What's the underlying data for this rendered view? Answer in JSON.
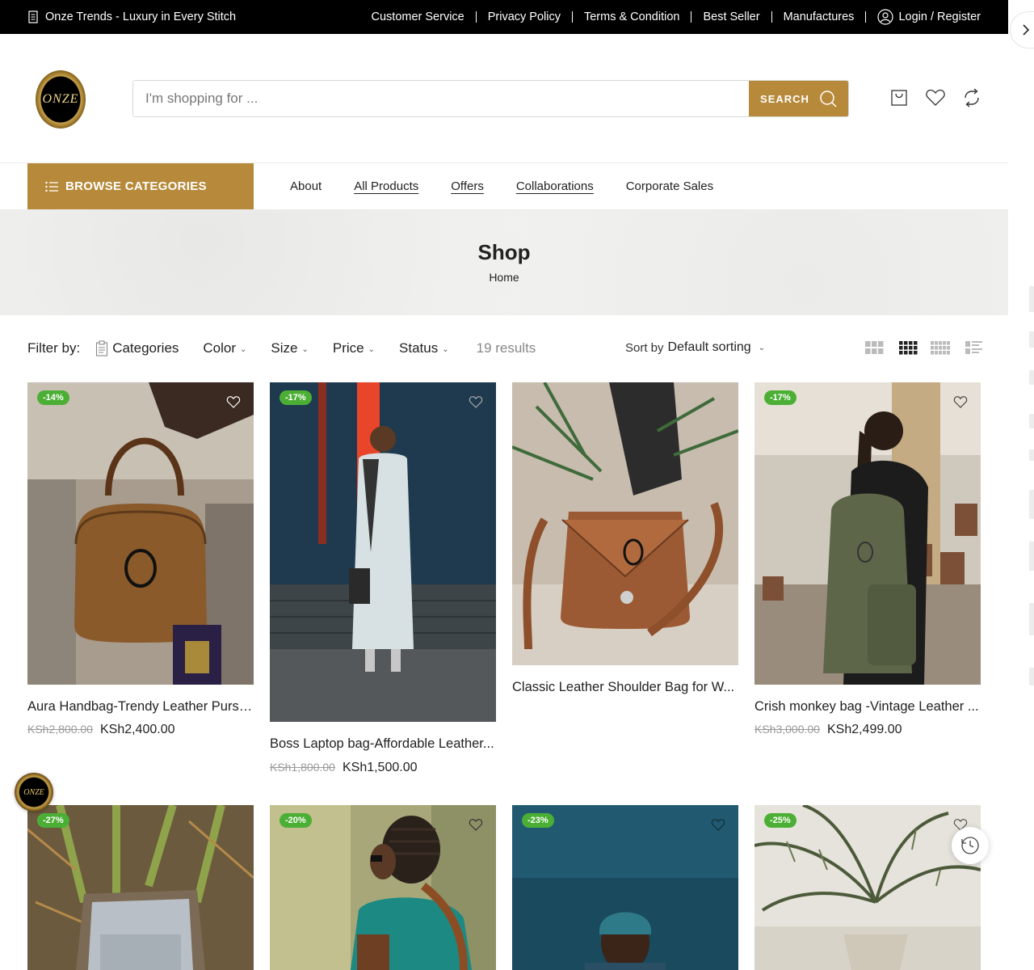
{
  "topbar": {
    "tagline": "Onze Trends - Luxury in Every Stitch",
    "links": [
      "Customer Service",
      "Privacy Policy",
      "Terms & Condition",
      "Best Seller",
      "Manufactures"
    ],
    "login": "Login / Register"
  },
  "header": {
    "logo_text": "ONZE",
    "search": {
      "placeholder": "I'm shopping for ...",
      "value": "",
      "button": "SEARCH"
    }
  },
  "nav": {
    "browse": "BROWSE CATEGORIES",
    "links": [
      "About",
      "All Products",
      "Offers",
      "Collaborations",
      "Corporate Sales"
    ]
  },
  "banner": {
    "title": "Shop",
    "breadcrumb": "Home"
  },
  "filters": {
    "label": "Filter by:",
    "items": [
      "Categories",
      "Color",
      "Size",
      "Price",
      "Status"
    ],
    "results": "19 results",
    "sort_prefix": "Sort by",
    "sort_value": "Default sorting"
  },
  "products": [
    {
      "badge": "-14%",
      "name": "Aura Handbag-Trendy Leather Purse...",
      "old_price": "KSh2,800.00",
      "price": "KSh2,400.00"
    },
    {
      "badge": "-17%",
      "name": "Boss Laptop bag-Affordable Leather...",
      "old_price": "KSh1,800.00",
      "price": "KSh1,500.00"
    },
    {
      "badge": "",
      "name": "Classic Leather Shoulder Bag for W...",
      "old_price": "",
      "price": ""
    },
    {
      "badge": "-17%",
      "name": "Crish monkey bag -Vintage Leather ...",
      "old_price": "KSh3,000.00",
      "price": "KSh2,499.00"
    },
    {
      "badge": "-27%",
      "name": "",
      "old_price": "",
      "price": ""
    },
    {
      "badge": "-20%",
      "name": "",
      "old_price": "",
      "price": ""
    },
    {
      "badge": "-23%",
      "name": "",
      "old_price": "",
      "price": ""
    },
    {
      "badge": "-25%",
      "name": "",
      "old_price": "",
      "price": ""
    }
  ],
  "colors": {
    "accent": "#b78a3b",
    "topbar": "#000000",
    "sale_badge": "#4caf35"
  },
  "float": {
    "logo_text": "ONZE"
  }
}
